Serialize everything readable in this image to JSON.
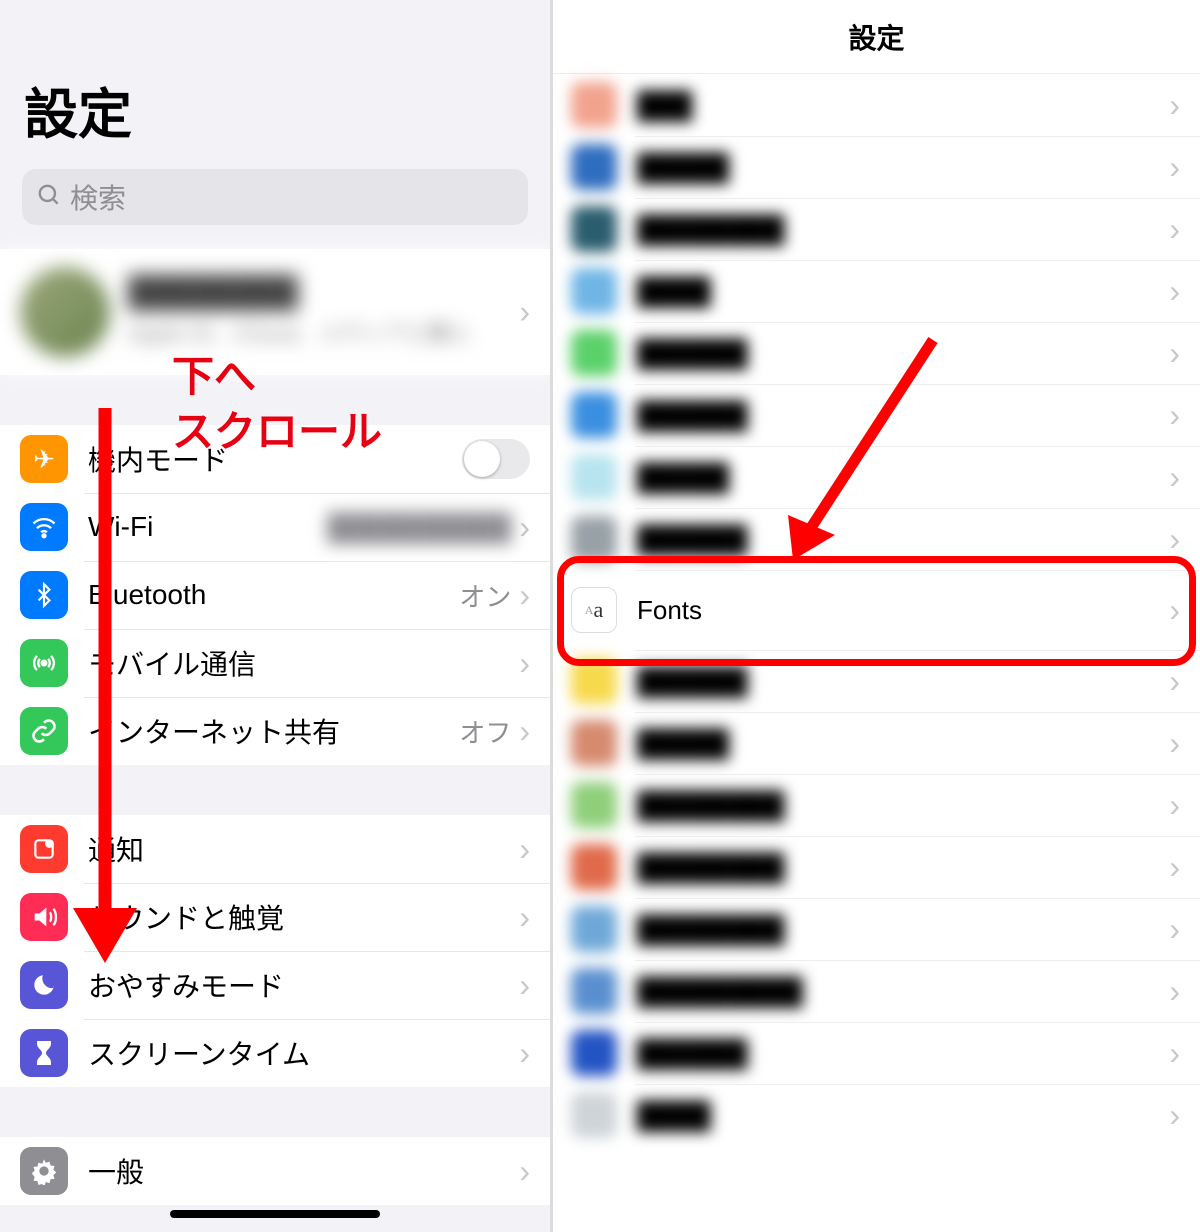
{
  "left": {
    "title": "設定",
    "search_placeholder": "検索",
    "profile_name": "████████",
    "profile_sub": "Apple ID、iCloud、メディアと購入",
    "annotation_line1": "下へ",
    "annotation_line2": "スクロール",
    "rows1": [
      {
        "label": "機内モード",
        "value": "",
        "icon_bg": "#ff9500",
        "icon_glyph": "✈",
        "has_toggle": true
      },
      {
        "label": "Wi-Fi",
        "value": "██████████",
        "icon_bg": "#007aff",
        "icon_glyph": "wifi"
      },
      {
        "label": "Bluetooth",
        "value": "オン",
        "icon_bg": "#007aff",
        "icon_glyph": "bt"
      },
      {
        "label": "モバイル通信",
        "value": "",
        "icon_bg": "#34c759",
        "icon_glyph": "ant"
      },
      {
        "label": "インターネット共有",
        "value": "オフ",
        "icon_bg": "#34c759",
        "icon_glyph": "link"
      }
    ],
    "rows2": [
      {
        "label": "通知",
        "value": "",
        "icon_bg": "#ff3b30",
        "icon_glyph": "bell"
      },
      {
        "label": "サウンドと触覚",
        "value": "",
        "icon_bg": "#ff2d55",
        "icon_glyph": "sound"
      },
      {
        "label": "おやすみモード",
        "value": "",
        "icon_bg": "#5856d6",
        "icon_glyph": "moon"
      },
      {
        "label": "スクリーンタイム",
        "value": "",
        "icon_bg": "#5856d6",
        "icon_glyph": "hour"
      }
    ],
    "rows3": [
      {
        "label": "一般",
        "value": "",
        "icon_bg": "#8e8e93",
        "icon_glyph": "gear"
      }
    ]
  },
  "right": {
    "title": "設定",
    "fonts_label": "Fonts",
    "rows": [
      {
        "label": "███",
        "bg": "#f2a38e"
      },
      {
        "label": "█████",
        "bg": "#2f6dc0"
      },
      {
        "label": "████████",
        "bg": "#2a5d6e"
      },
      {
        "label": "████",
        "bg": "#6fb5e6"
      },
      {
        "label": "██████",
        "bg": "#5bd16a"
      },
      {
        "label": "██████",
        "bg": "#3a8fe0"
      },
      {
        "label": "█████",
        "bg": "#b8e4ef"
      },
      {
        "label": "██████",
        "bg": "#98a1a7"
      },
      {
        "label": "Fonts",
        "bg": "#ffffff",
        "is_fonts": true
      },
      {
        "label": "██████",
        "bg": "#f7d94c"
      },
      {
        "label": "█████",
        "bg": "#d68a6e"
      },
      {
        "label": "████████",
        "bg": "#8fcf7a"
      },
      {
        "label": "████████",
        "bg": "#e06a4a"
      },
      {
        "label": "████████",
        "bg": "#6fa8d8"
      },
      {
        "label": "█████████",
        "bg": "#5a8fcf"
      },
      {
        "label": "██████",
        "bg": "#2354c4"
      },
      {
        "label": "████",
        "bg": "#cfd4d8"
      }
    ]
  }
}
